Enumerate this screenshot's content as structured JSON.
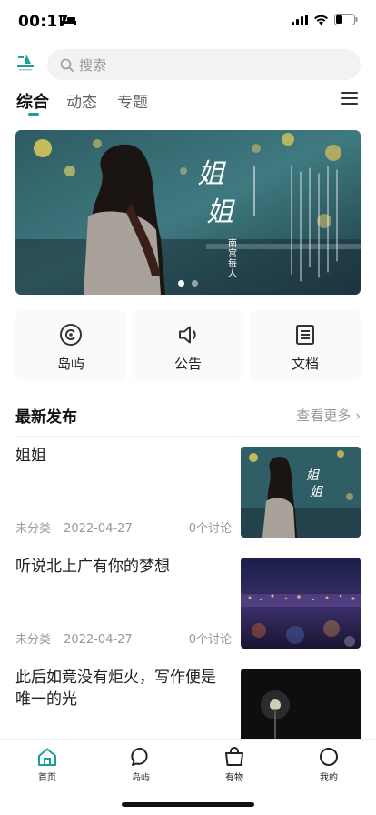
{
  "status": {
    "time": "00:17"
  },
  "search": {
    "placeholder": "搜索"
  },
  "tabs": [
    {
      "label": "综合",
      "active": true
    },
    {
      "label": "动态",
      "active": false
    },
    {
      "label": "专题",
      "active": false
    }
  ],
  "banner": {
    "text_lines": [
      "姐",
      "姐"
    ],
    "caption": "南宫每人",
    "slides": 2,
    "current_slide": 1
  },
  "shortcuts": [
    {
      "label": "岛屿",
      "icon": "island-icon"
    },
    {
      "label": "公告",
      "icon": "speaker-icon"
    },
    {
      "label": "文档",
      "icon": "document-icon"
    }
  ],
  "section": {
    "title": "最新发布",
    "more": "查看更多 ›"
  },
  "articles": [
    {
      "title": "姐姐",
      "category": "未分类",
      "date": "2022-04-27",
      "comments": "0个讨论"
    },
    {
      "title": "听说北上广有你的梦想",
      "category": "未分类",
      "date": "2022-04-27",
      "comments": "0个讨论"
    },
    {
      "title": "此后如竟没有炬火，写作便是唯一的光",
      "category": "",
      "date": "",
      "comments": ""
    }
  ],
  "tabbar": [
    {
      "label": "首页",
      "icon": "home-icon",
      "active": true
    },
    {
      "label": "岛屿",
      "icon": "chat-bubble-icon",
      "active": false
    },
    {
      "label": "有物",
      "icon": "shopping-bag-icon",
      "active": false
    },
    {
      "label": "我的",
      "icon": "profile-circle-icon",
      "active": false
    }
  ],
  "colors": {
    "accent": "#1f9e96",
    "text": "#222222",
    "muted": "#999999"
  }
}
